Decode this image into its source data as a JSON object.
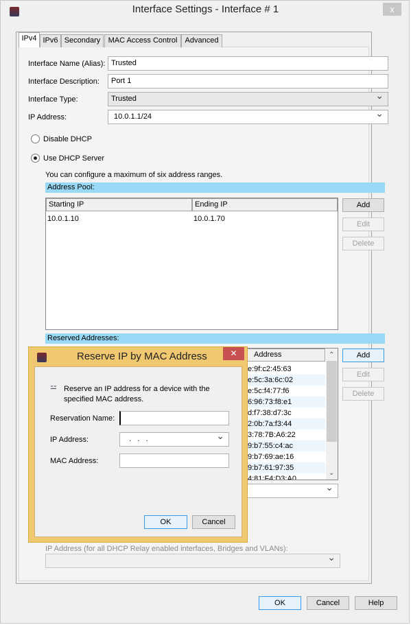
{
  "window": {
    "title": "Interface Settings - Interface # 1",
    "close": "x"
  },
  "tabs": [
    {
      "label": "IPv4"
    },
    {
      "label": "IPv6"
    },
    {
      "label": "Secondary"
    },
    {
      "label": "MAC Access Control"
    },
    {
      "label": "Advanced"
    }
  ],
  "form": {
    "name_label": "Interface Name (Alias):",
    "name_value": "Trusted",
    "desc_label": "Interface Description:",
    "desc_value": "Port 1",
    "type_label": "Interface Type:",
    "type_value": "Trusted",
    "ip_label": "IP Address:",
    "ip_value": "10.0.1.1/24"
  },
  "dhcp": {
    "disable_label": "Disable DHCP",
    "use_label": "Use DHCP Server",
    "selected": "Use DHCP Server",
    "hint": "You can configure a maximum of six address ranges.",
    "pool_title": "Address Pool:",
    "pool_columns": [
      "Starting IP",
      "Ending IP"
    ],
    "pool_rows": [
      [
        "10.0.1.10",
        "10.0.1.70"
      ]
    ],
    "reserved_title": "Reserved Addresses:",
    "reserved_column_visible": "Address",
    "reserved_rows": [
      "e:9f:c2:45:63",
      "e:5c:3a:6c:02",
      "e:5c:f4:77:f6",
      "6:96:73:f8:e1",
      "d:f7:38:d7:3c",
      "2:0b:7a:f3:44",
      "3:78:7B:A6:22",
      "9:b7:55:c4:ac",
      "9:b7:69:ae:16",
      "9:b7:61:97:35",
      "4:81:F4:D3:A0"
    ],
    "add": "Add",
    "edit": "Edit",
    "delete": "Delete",
    "relay_label": "IP Address (for all DHCP Relay enabled interfaces, Bridges and VLANs):"
  },
  "footer": {
    "ok": "OK",
    "cancel": "Cancel",
    "help": "Help"
  },
  "dialog": {
    "title": "Reserve IP by MAC Address",
    "close": "✕",
    "description_line1": "Reserve an IP address for a device with the",
    "description_line2": "specified MAC address.",
    "name_label": "Reservation Name:",
    "name_value": "",
    "ip_label": "IP Address:",
    "ip_value": "   .   .   .",
    "mac_label": "MAC Address:",
    "mac_value": "",
    "ok": "OK",
    "cancel": "Cancel"
  },
  "colors": {
    "section_bar": "#99d9f5",
    "dialog_frame": "#f0c870",
    "dialog_close": "#c75050"
  }
}
